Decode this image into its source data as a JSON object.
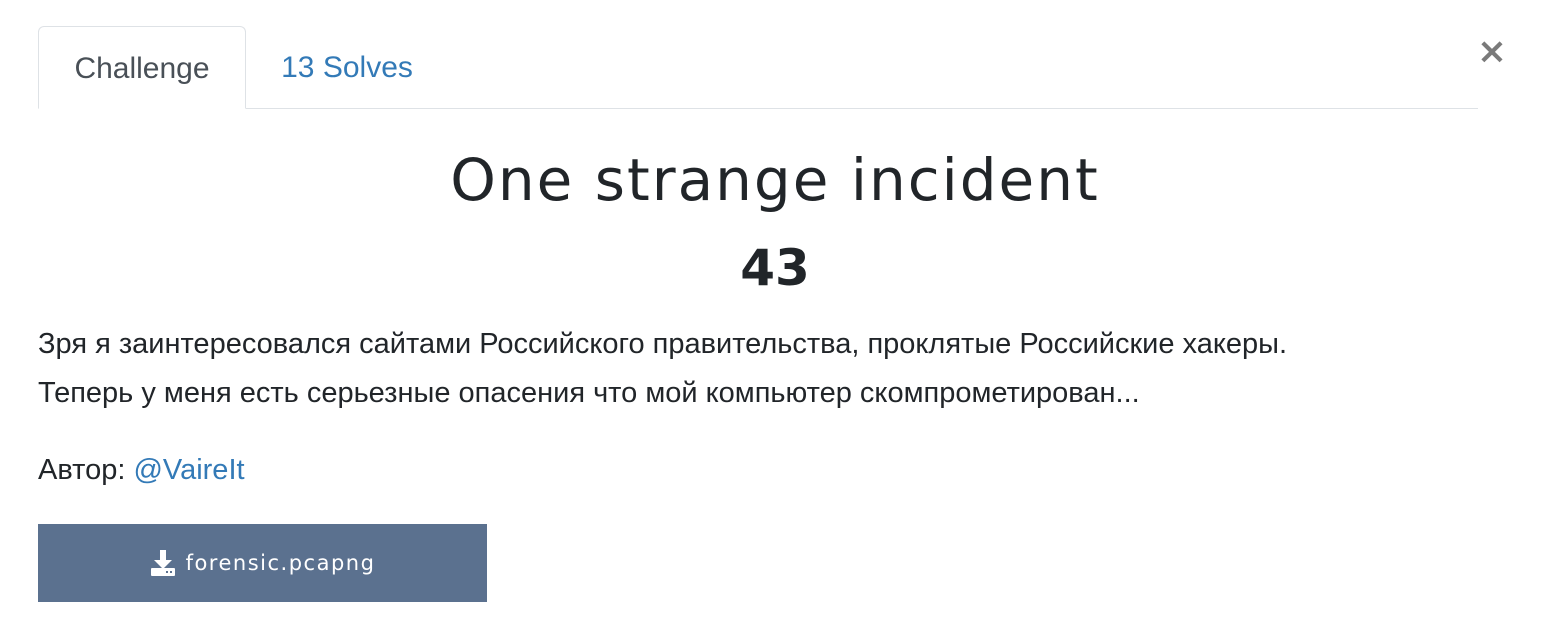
{
  "close": {
    "glyph": "×",
    "icon": "close-icon"
  },
  "tabs": [
    {
      "label": "Challenge",
      "active": true
    },
    {
      "label": "13 Solves",
      "active": false
    }
  ],
  "challenge": {
    "name": "One strange incident",
    "points": "43",
    "description_lines": [
      "Зря я заинтересовался сайтами Российского правительства, проклятые Российские хакеры.",
      "Теперь у меня есть серьезные опасения что мой компьютер скомпрометирован..."
    ],
    "author_label": "Автор:",
    "author_handle": "@VaireIt"
  },
  "file": {
    "name": "forensic.pcapng",
    "icon": "download-icon"
  },
  "colors": {
    "link": "#337ab7",
    "download_button": "#5b718f",
    "text": "#212529"
  }
}
